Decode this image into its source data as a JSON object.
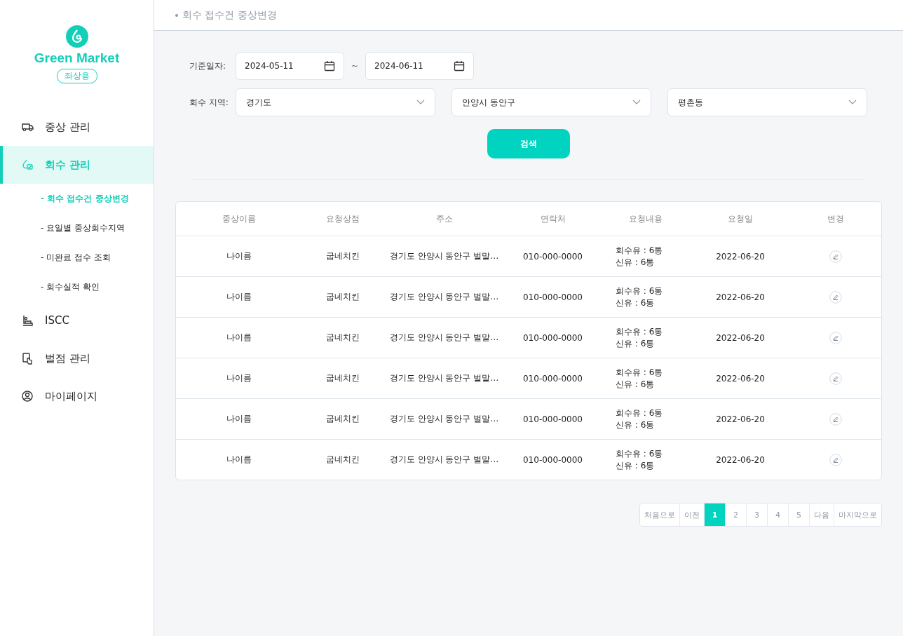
{
  "logo": {
    "name": "Green Market",
    "badge": "좌상용"
  },
  "sidebar": {
    "items": [
      {
        "label": "중상 관리",
        "selected": false
      },
      {
        "label": "회수 관리",
        "selected": true,
        "children": [
          {
            "label": "- 회수 접수건 중상변경",
            "selected": true
          },
          {
            "label": "- 요일별 중상회수지역",
            "selected": false
          },
          {
            "label": "- 미완료 접수 조회",
            "selected": false
          },
          {
            "label": "- 회수실적 확인",
            "selected": false
          }
        ]
      },
      {
        "label": "ISCC",
        "selected": false
      },
      {
        "label": "벌점 관리",
        "selected": false
      },
      {
        "label": "마이페이지",
        "selected": false
      }
    ]
  },
  "header": {
    "breadcrumb": "회수 접수건 중상변경"
  },
  "filters": {
    "date_label": "기준일자:",
    "date_from": "2024-05-11",
    "separator": "~",
    "date_to": "2024-06-11",
    "region_label": "회수 지역:",
    "regions": [
      "경기도",
      "안양시 동안구",
      "평촌동"
    ],
    "search_button": "검색"
  },
  "table": {
    "columns": [
      "중상이름",
      "요청상점",
      "주소",
      "연락처",
      "요청내용",
      "요청일",
      "변경"
    ],
    "rows": [
      {
        "name": "나이름",
        "store": "굽네치킨",
        "address": "경기도 안양시 동안구 벌말…",
        "phone": "010-000-0000",
        "content": [
          "회수유 : 6통",
          "신유 : 6통"
        ],
        "date": "2022-06-20"
      },
      {
        "name": "나이름",
        "store": "굽네치킨",
        "address": "경기도 안양시 동안구 벌말…",
        "phone": "010-000-0000",
        "content": [
          "회수유 : 6통",
          "신유 : 6통"
        ],
        "date": "2022-06-20"
      },
      {
        "name": "나이름",
        "store": "굽네치킨",
        "address": "경기도 안양시 동안구 벌말…",
        "phone": "010-000-0000",
        "content": [
          "회수유 : 6통",
          "신유 : 6통"
        ],
        "date": "2022-06-20"
      },
      {
        "name": "나이름",
        "store": "굽네치킨",
        "address": "경기도 안양시 동안구 벌말…",
        "phone": "010-000-0000",
        "content": [
          "회수유 : 6통",
          "신유 : 6통"
        ],
        "date": "2022-06-20"
      },
      {
        "name": "나이름",
        "store": "굽네치킨",
        "address": "경기도 안양시 동안구 벌말…",
        "phone": "010-000-0000",
        "content": [
          "회수유 : 6통",
          "신유 : 6통"
        ],
        "date": "2022-06-20"
      },
      {
        "name": "나이름",
        "store": "굽네치킨",
        "address": "경기도 안양시 동안구 벌말…",
        "phone": "010-000-0000",
        "content": [
          "회수유 : 6통",
          "신유 : 6통"
        ],
        "date": "2022-06-20"
      }
    ]
  },
  "pagination": {
    "first": "처음으로",
    "prev": "이전",
    "pages": [
      {
        "label": "1",
        "selected": true
      },
      {
        "label": "2",
        "selected": false
      },
      {
        "label": "3",
        "selected": false
      },
      {
        "label": "4",
        "selected": false
      },
      {
        "label": "5",
        "selected": false
      }
    ],
    "next": "다음",
    "last": "마지막으로"
  }
}
